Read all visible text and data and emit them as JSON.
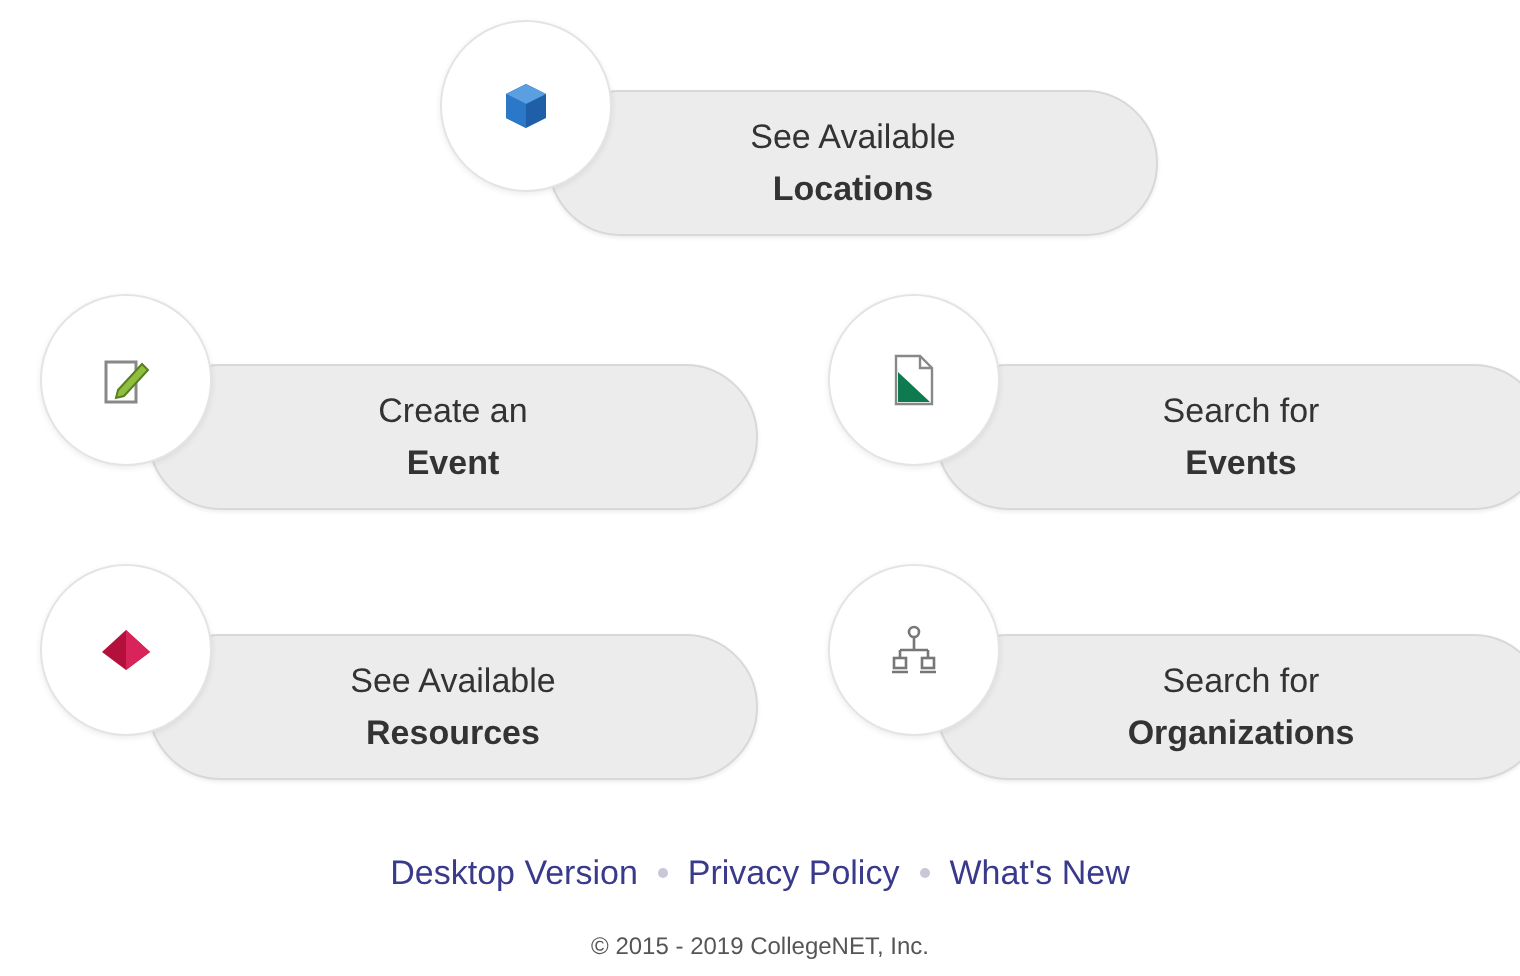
{
  "tiles": [
    {
      "kind": "cube",
      "line1": "See Available",
      "line2": "Locations"
    },
    {
      "kind": "pencil",
      "line1": "Create an",
      "line2": "Event"
    },
    {
      "kind": "document",
      "line1": "Search for",
      "line2": "Events"
    },
    {
      "kind": "pyramid",
      "line1": "See Available",
      "line2": "Resources"
    },
    {
      "kind": "orgchart",
      "line1": "Search for",
      "line2": "Organizations"
    }
  ],
  "footer": {
    "links": [
      "Desktop Version",
      "Privacy Policy",
      "What's New"
    ],
    "copyright": "© 2015 - 2019 CollegeNET, Inc."
  }
}
